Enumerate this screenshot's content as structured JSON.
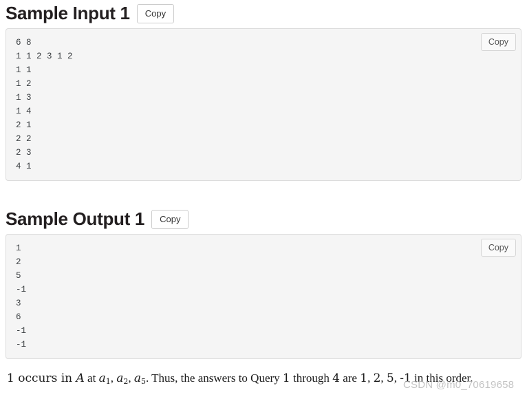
{
  "sections": [
    {
      "title": "Sample Input 1",
      "heading_copy_label": "Copy",
      "code_copy_label": "Copy",
      "content": "6 8\n1 1 2 3 1 2\n1 1\n1 2\n1 3\n1 4\n2 1\n2 2\n2 3\n4 1"
    },
    {
      "title": "Sample Output 1",
      "heading_copy_label": "Copy",
      "code_copy_label": "Copy",
      "content": "1\n2\n5\n-1\n3\n6\n-1\n-1"
    }
  ],
  "explanation": {
    "part1": "1 occurs in ",
    "var_A": "A",
    "part2": " at ",
    "a1": "a",
    "a1_sub": "1",
    "comma1": ", ",
    "a2": "a",
    "a2_sub": "2",
    "comma2": ", ",
    "a5": "a",
    "a5_sub": "5",
    "part3": ". Thus, the answers to Query ",
    "q_from": "1",
    "part4": " through ",
    "q_to": "4",
    "part5": " are ",
    "ans1": "1",
    "ans_sep1": ", ",
    "ans2": "2",
    "ans_sep2": ", ",
    "ans3": "5",
    "ans_sep3": ", ",
    "ans4": "-1",
    "part6": " in this order."
  },
  "watermark": {
    "text": "CSDN @m0_70619658"
  }
}
